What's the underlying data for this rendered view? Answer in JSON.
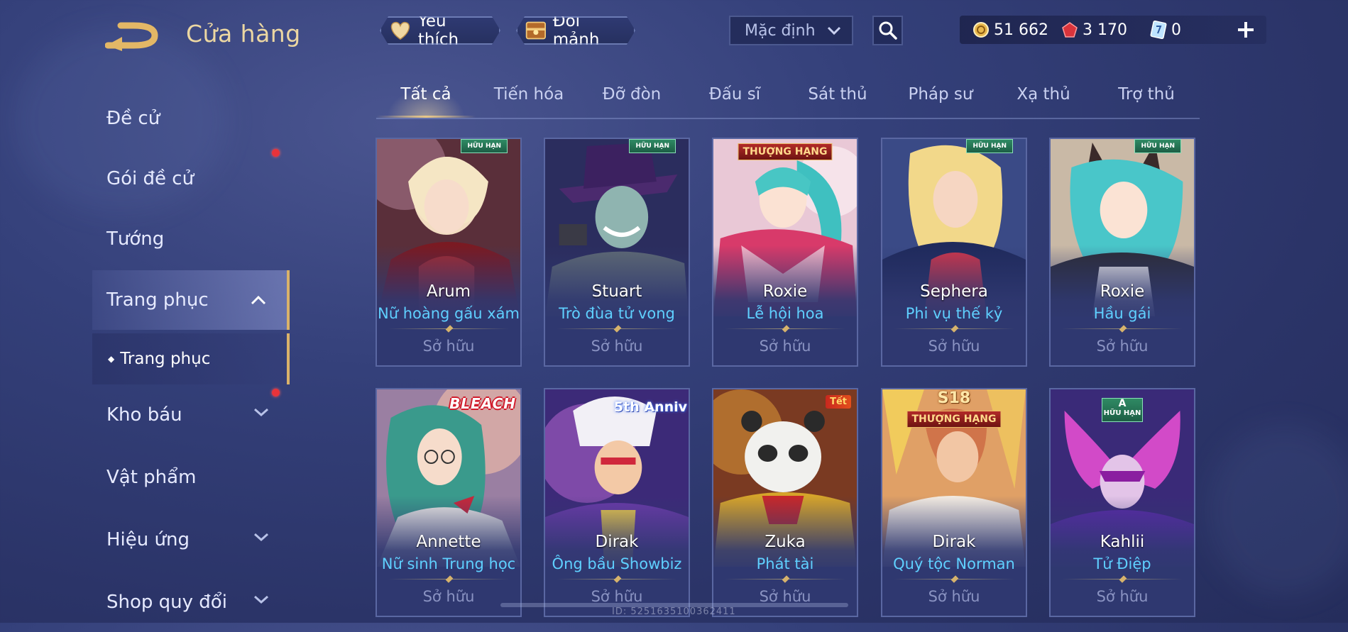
{
  "header": {
    "title": "Cửa hàng",
    "favorites_label": "Yêu thích",
    "exchange_label": "Đổi mảnh",
    "sort_value": "Mặc định",
    "currencies": {
      "gold": "51 662",
      "ruby": "3 170",
      "voucher": "0"
    }
  },
  "sidebar": {
    "items": [
      {
        "label": "Đề cử"
      },
      {
        "label": "Gói đề cử"
      },
      {
        "label": "Tướng"
      },
      {
        "label": "Trang phục"
      },
      {
        "label": "Trang phục"
      },
      {
        "label": "Kho báu"
      },
      {
        "label": "Vật phẩm"
      },
      {
        "label": "Hiệu ứng"
      },
      {
        "label": "Shop quy đổi"
      }
    ]
  },
  "tabs": [
    "Tất cả",
    "Tiến hóa",
    "Đỡ đòn",
    "Đấu sĩ",
    "Sát thủ",
    "Pháp sư",
    "Xạ thủ",
    "Trợ thủ"
  ],
  "cards": [
    {
      "hero": "Arum",
      "skin": "Nữ hoàng gấu xám",
      "status": "Sở hữu",
      "badge": "HỮU HẠN"
    },
    {
      "hero": "Stuart",
      "skin": "Trò đùa tử vong",
      "status": "Sở hữu",
      "badge": "HỮU HẠN"
    },
    {
      "hero": "Roxie",
      "skin": "Lễ hội hoa",
      "status": "Sở hữu",
      "badge": "THƯỢNG HẠNG"
    },
    {
      "hero": "Sephera",
      "skin": "Phi vụ thế kỷ",
      "status": "Sở hữu",
      "badge": "HỮU HẠN"
    },
    {
      "hero": "Roxie",
      "skin": "Hầu gái",
      "status": "Sở hữu",
      "badge": "HỮU HẠN"
    },
    {
      "hero": "Annette",
      "skin": "Nữ sinh Trung học",
      "status": "Sở hữu",
      "badge": "BLEACH"
    },
    {
      "hero": "Dirak",
      "skin": "Ông bầu Showbiz",
      "status": "Sở hữu",
      "badge": "5th Anniv"
    },
    {
      "hero": "Zuka",
      "skin": "Phát tài",
      "status": "Sở hữu",
      "badge": "Tết"
    },
    {
      "hero": "Dirak",
      "skin": "Quý tộc Norman",
      "status": "Sở hữu",
      "badge": "THƯỢNG HẠNG",
      "season": "S18"
    },
    {
      "hero": "Kahlii",
      "skin": "Tử Điệp",
      "status": "Sở hữu",
      "badge": "HỮU HẠN",
      "grade": "A"
    }
  ],
  "colors": {
    "accent_gold": "#ecd7a2",
    "skin_name": "#5fd0ff",
    "owned": "#8a93c2",
    "badge_red": "#e8333a"
  },
  "footer": {
    "id_text": "ID: 5251635100362411"
  }
}
